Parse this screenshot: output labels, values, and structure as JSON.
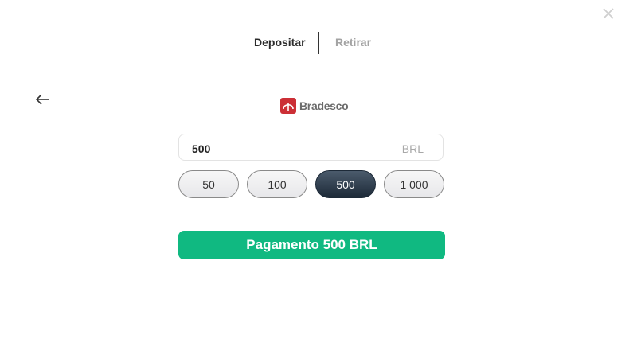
{
  "tabs": {
    "deposit": "Depositar",
    "withdraw": "Retirar"
  },
  "bank": {
    "name": "Bradesco",
    "brand_color": "#cc2f36"
  },
  "amount": {
    "value": "500",
    "currency": "BRL"
  },
  "presets": [
    {
      "label": "50",
      "selected": false
    },
    {
      "label": "100",
      "selected": false
    },
    {
      "label": "500",
      "selected": true
    },
    {
      "label": "1 000",
      "selected": false
    }
  ],
  "pay_button": {
    "label": "Pagamento 500 BRL",
    "color": "#10b981"
  },
  "icons": {
    "close": "close-icon",
    "back": "arrow-left-icon"
  }
}
